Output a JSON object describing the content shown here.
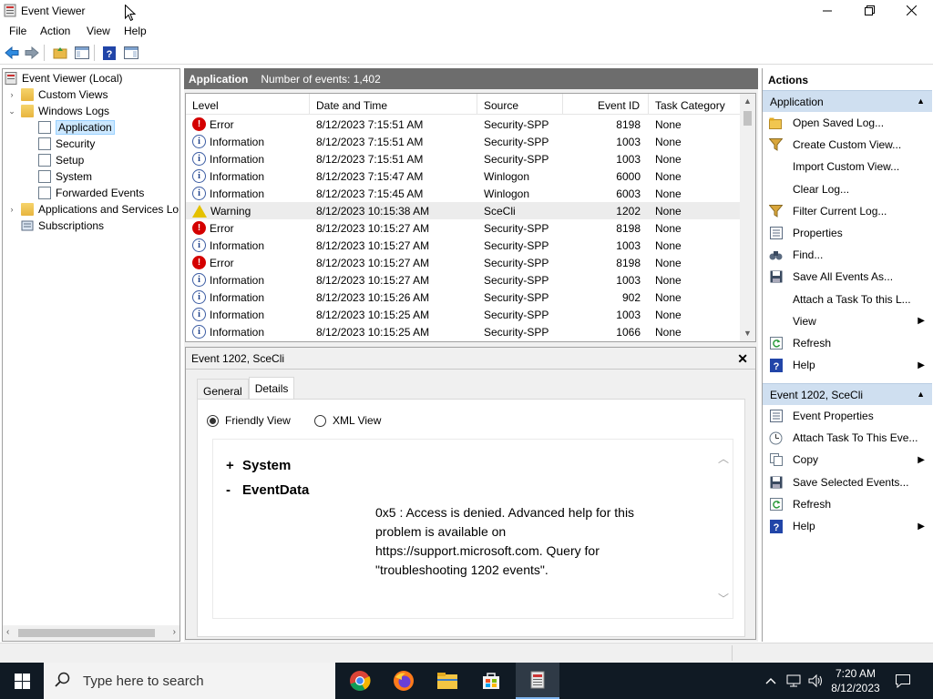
{
  "window": {
    "title": "Event Viewer"
  },
  "menu": [
    "File",
    "Action",
    "View",
    "Help"
  ],
  "tree": {
    "items": [
      {
        "label": "Event Viewer (Local)",
        "expander": ""
      },
      {
        "label": "Custom Views",
        "expander": "›"
      },
      {
        "label": "Windows Logs",
        "expander": "⌄"
      },
      {
        "label": "Application",
        "expander": ""
      },
      {
        "label": "Security",
        "expander": ""
      },
      {
        "label": "Setup",
        "expander": ""
      },
      {
        "label": "System",
        "expander": ""
      },
      {
        "label": "Forwarded Events",
        "expander": ""
      },
      {
        "label": "Applications and Services Lo",
        "expander": "›"
      },
      {
        "label": "Subscriptions",
        "expander": ""
      }
    ]
  },
  "center": {
    "log_name": "Application",
    "count_text": "Number of events: 1,402",
    "columns": [
      "Level",
      "Date and Time",
      "Source",
      "Event ID",
      "Task Category"
    ],
    "rows": [
      {
        "level": "Error",
        "type": "error",
        "date": "8/12/2023 7:15:51 AM",
        "source": "Security-SPP",
        "id": "8198",
        "task": "None"
      },
      {
        "level": "Information",
        "type": "info",
        "date": "8/12/2023 7:15:51 AM",
        "source": "Security-SPP",
        "id": "1003",
        "task": "None"
      },
      {
        "level": "Information",
        "type": "info",
        "date": "8/12/2023 7:15:51 AM",
        "source": "Security-SPP",
        "id": "1003",
        "task": "None"
      },
      {
        "level": "Information",
        "type": "info",
        "date": "8/12/2023 7:15:47 AM",
        "source": "Winlogon",
        "id": "6000",
        "task": "None"
      },
      {
        "level": "Information",
        "type": "info",
        "date": "8/12/2023 7:15:45 AM",
        "source": "Winlogon",
        "id": "6003",
        "task": "None"
      },
      {
        "level": "Warning",
        "type": "warn",
        "date": "8/12/2023 10:15:38 AM",
        "source": "SceCli",
        "id": "1202",
        "task": "None"
      },
      {
        "level": "Error",
        "type": "error",
        "date": "8/12/2023 10:15:27 AM",
        "source": "Security-SPP",
        "id": "8198",
        "task": "None"
      },
      {
        "level": "Information",
        "type": "info",
        "date": "8/12/2023 10:15:27 AM",
        "source": "Security-SPP",
        "id": "1003",
        "task": "None"
      },
      {
        "level": "Error",
        "type": "error",
        "date": "8/12/2023 10:15:27 AM",
        "source": "Security-SPP",
        "id": "8198",
        "task": "None"
      },
      {
        "level": "Information",
        "type": "info",
        "date": "8/12/2023 10:15:27 AM",
        "source": "Security-SPP",
        "id": "1003",
        "task": "None"
      },
      {
        "level": "Information",
        "type": "info",
        "date": "8/12/2023 10:15:26 AM",
        "source": "Security-SPP",
        "id": "902",
        "task": "None"
      },
      {
        "level": "Information",
        "type": "info",
        "date": "8/12/2023 10:15:25 AM",
        "source": "Security-SPP",
        "id": "1003",
        "task": "None"
      },
      {
        "level": "Information",
        "type": "info",
        "date": "8/12/2023 10:15:25 AM",
        "source": "Security-SPP",
        "id": "1066",
        "task": "None"
      }
    ]
  },
  "detail": {
    "title": "Event 1202, SceCli",
    "tabs": [
      "General",
      "Details"
    ],
    "friendly_label": "Friendly View",
    "xml_label": "XML View",
    "system": {
      "sign": "+",
      "label": "System"
    },
    "eventdata": {
      "sign": "-",
      "label": "EventData"
    },
    "message": "0x5 : Access is denied. Advanced help for this problem is available on https://support.microsoft.com. Query for \"troubleshooting 1202 events\"."
  },
  "actions": {
    "header": "Actions",
    "section1": "Application",
    "items1": [
      {
        "label": "Open Saved Log...",
        "icon": "folder-open-icon",
        "sub": false
      },
      {
        "label": "Create Custom View...",
        "icon": "filter-icon",
        "sub": false
      },
      {
        "label": "Import Custom View...",
        "icon": "",
        "sub": false
      },
      {
        "label": "Clear Log...",
        "icon": "",
        "sub": false
      },
      {
        "label": "Filter Current Log...",
        "icon": "filter-icon",
        "sub": false
      },
      {
        "label": "Properties",
        "icon": "properties-icon",
        "sub": false
      },
      {
        "label": "Find...",
        "icon": "find-icon",
        "sub": false
      },
      {
        "label": "Save All Events As...",
        "icon": "save-icon",
        "sub": false
      },
      {
        "label": "Attach a Task To this L...",
        "icon": "",
        "sub": false
      },
      {
        "label": "View",
        "icon": "",
        "sub": true
      },
      {
        "label": "Refresh",
        "icon": "refresh-icon",
        "sub": false
      },
      {
        "label": "Help",
        "icon": "help-icon",
        "sub": true
      }
    ],
    "section2": "Event 1202, SceCli",
    "items2": [
      {
        "label": "Event Properties",
        "icon": "properties-icon",
        "sub": false
      },
      {
        "label": "Attach Task To This Eve...",
        "icon": "task-icon",
        "sub": false
      },
      {
        "label": "Copy",
        "icon": "copy-icon",
        "sub": true
      },
      {
        "label": "Save Selected Events...",
        "icon": "save-icon",
        "sub": false
      },
      {
        "label": "Refresh",
        "icon": "refresh-icon",
        "sub": false
      },
      {
        "label": "Help",
        "icon": "help-icon",
        "sub": true
      }
    ]
  },
  "taskbar": {
    "search_placeholder": "Type here to search",
    "time": "7:20 AM",
    "date": "8/12/2023"
  }
}
